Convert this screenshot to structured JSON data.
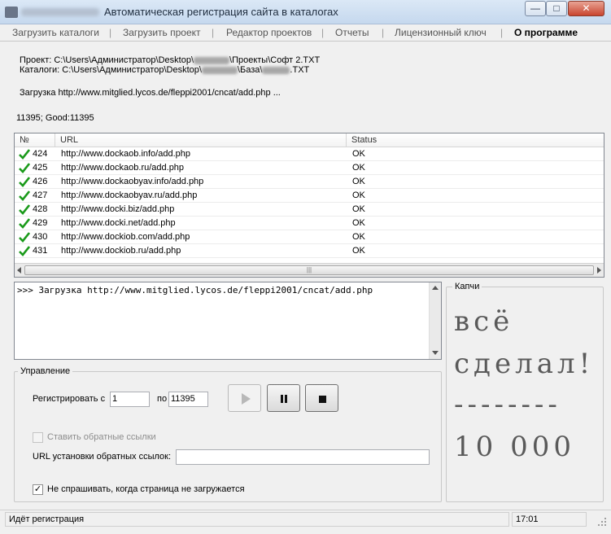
{
  "window": {
    "title": "Автоматическая регистрация сайта в каталогах",
    "minimize_glyph": "—",
    "maximize_glyph": "□",
    "close_glyph": "✕"
  },
  "menu": {
    "items": [
      "Загрузить каталоги",
      "Загрузить проект",
      "Редактор проектов",
      "Отчеты",
      "Лицензионный ключ",
      "О программе"
    ],
    "separator": "|"
  },
  "info": {
    "project_prefix": "Проект: C:\\Users\\Администратор\\Desktop\\",
    "project_suffix": "\\Проекты\\Софт 2.TXT",
    "catalogs_prefix": "Каталоги: C:\\Users\\Администратор\\Desktop\\",
    "catalogs_mid": "\\База\\",
    "catalogs_suffix": ".TXT",
    "loading": "Загрузка http://www.mitglied.lycos.de/fleppi2001/cncat/add.php ...",
    "counter": "11395; Good:11395"
  },
  "table": {
    "headers": [
      "№",
      "URL",
      "Status"
    ],
    "rows": [
      {
        "n": "424",
        "url": "http://www.dockaob.info/add.php",
        "status": "OK"
      },
      {
        "n": "425",
        "url": "http://www.dockaob.ru/add.php",
        "status": "OK"
      },
      {
        "n": "426",
        "url": "http://www.dockaobyav.info/add.php",
        "status": "OK"
      },
      {
        "n": "427",
        "url": "http://www.dockaobyav.ru/add.php",
        "status": "OK"
      },
      {
        "n": "428",
        "url": "http://www.docki.biz/add.php",
        "status": "OK"
      },
      {
        "n": "429",
        "url": "http://www.docki.net/add.php",
        "status": "OK"
      },
      {
        "n": "430",
        "url": "http://www.dockiob.com/add.php",
        "status": "OK"
      },
      {
        "n": "431",
        "url": "http://www.dockiob.ru/add.php",
        "status": "OK"
      }
    ],
    "scroll_grip": "|||",
    "check_color": "#1a9a1a"
  },
  "log": {
    "text": ">>> Загрузка http://www.mitglied.lycos.de/fleppi2001/cncat/add.php"
  },
  "control": {
    "group_label": "Управление",
    "register_from_label": "Регистрировать с",
    "from_value": "1",
    "to_label": "по",
    "to_value": "11395",
    "backlinks_label": "Ставить обратные ссылки",
    "backlinks_url_label": "URL установки обратных ссылок:",
    "backlinks_url_value": "",
    "no_ask_label": "Не спрашивать, когда страница не загружается",
    "no_ask_mark": "✓",
    "play_icon": "play-icon",
    "pause_icon": "pause-icon",
    "stop_icon": "stop-icon"
  },
  "captcha": {
    "label": "Капчи",
    "lines": [
      "всё",
      "сделал!",
      "--------",
      "10 000"
    ]
  },
  "status": {
    "text": "Идёт регистрация",
    "time": "17:01"
  }
}
